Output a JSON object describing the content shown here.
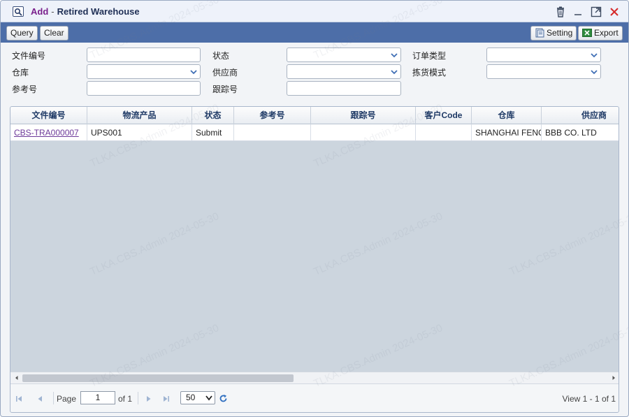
{
  "window": {
    "title_prefix": "Add",
    "title_separator": "-",
    "title_main": "Retired Warehouse",
    "icons": [
      "window-search-icon",
      "trash-icon",
      "minimize-icon",
      "maximize-icon",
      "close-icon"
    ]
  },
  "toolbar": {
    "query_label": "Query",
    "clear_label": "Clear",
    "setting_label": "Setting",
    "export_label": "Export"
  },
  "filters": {
    "doc_no_label": "文件编号",
    "status_label": "状态",
    "order_type_label": "订单类型",
    "warehouse_label": "仓库",
    "supplier_label": "供应商",
    "pick_mode_label": "拣货模式",
    "ref_no_label": "参考号",
    "tracking_no_label": "跟踪号"
  },
  "grid": {
    "columns": [
      "文件编号",
      "物流产品",
      "状态",
      "参考号",
      "跟踪号",
      "客户Code",
      "仓库",
      "供应商"
    ],
    "rows": [
      [
        "CBS-TRA000007",
        "UPS001",
        "Submit",
        "",
        "",
        "",
        "SHANGHAI FENGXIAN",
        "BBB CO. LTD"
      ]
    ]
  },
  "pager": {
    "page_label": "Page",
    "page_value": "1",
    "of_label": "of 1",
    "page_size": "50",
    "view_text": "View 1 - 1 of 1"
  },
  "watermark": "TLKA.CBS.Admin 2024-05-30",
  "colors": {
    "toolbar_bg": "#4d6ea8",
    "title_accent": "#7a1f8c",
    "link": "#6d3a99",
    "grid_bg": "#ccd5de"
  }
}
